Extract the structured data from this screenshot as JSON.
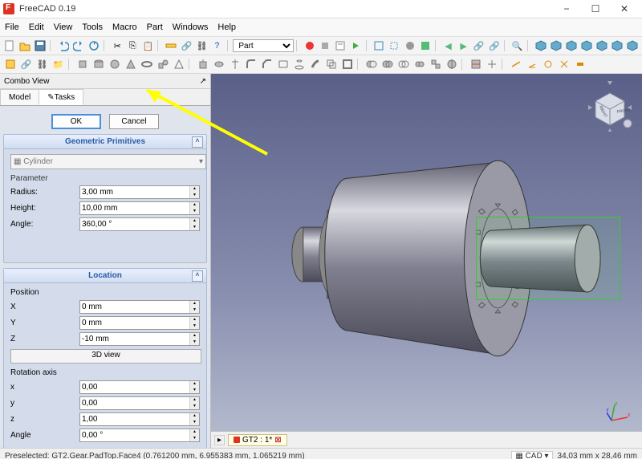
{
  "window": {
    "title": "FreeCAD 0.19"
  },
  "menu": {
    "items": [
      "File",
      "Edit",
      "View",
      "Tools",
      "Macro",
      "Part",
      "Windows",
      "Help"
    ]
  },
  "workbench": {
    "active": "Part"
  },
  "combo": {
    "title": "Combo View",
    "tabs": {
      "model": "Model",
      "tasks": "Tasks"
    },
    "ok": "OK",
    "cancel": "Cancel",
    "geom_hdr": "Geometric Primitives",
    "prim_type": "Cylinder",
    "param_hdr": "Parameter",
    "radius_lbl": "Radius:",
    "radius_val": "3,00 mm",
    "height_lbl": "Height:",
    "height_val": "10,00 mm",
    "angle_lbl": "Angle:",
    "angle_val": "360,00 °",
    "loc_hdr": "Location",
    "pos_hdr": "Position",
    "x_lbl": "X",
    "x_val": "0 mm",
    "y_lbl": "Y",
    "y_val": "0 mm",
    "z_lbl": "Z",
    "z_val": "-10 mm",
    "view_btn": "3D view",
    "rot_hdr": "Rotation axis",
    "rx_lbl": "x",
    "rx_val": "0,00",
    "ry_lbl": "y",
    "ry_val": "0,00",
    "rz_lbl": "z",
    "rz_val": "1,00",
    "rang_lbl": "Angle",
    "rang_val": "0,00 °"
  },
  "viewtab": {
    "label": "GT2 : 1*"
  },
  "status": {
    "left": "Preselected: GT2.Gear.PadTop.Face4 (0.761200 mm, 6.955383 mm, 1.065219 mm)",
    "nav": "CAD",
    "dims": "34,03 mm x 28,46 mm"
  },
  "navcube": {
    "front": "FRONT",
    "right": "RIGHT"
  },
  "colors": {
    "accent": "#4a90d9",
    "highlight": "#3c3",
    "arrow": "#ffff00"
  }
}
